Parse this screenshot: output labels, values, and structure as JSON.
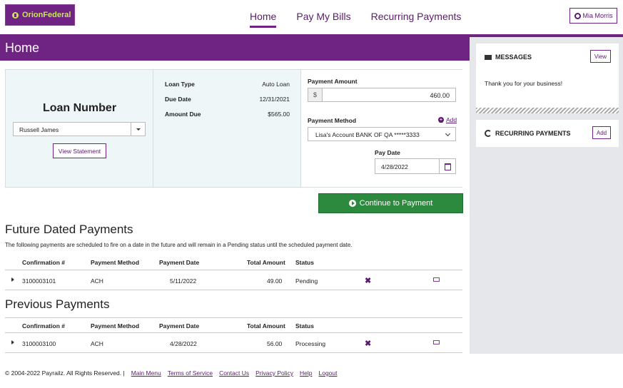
{
  "brand": {
    "name": "OrionFederal"
  },
  "nav": {
    "items": [
      "Home",
      "Pay My Bills",
      "Recurring Payments"
    ],
    "active": "Home"
  },
  "user": {
    "name": "Mia Morris",
    "icon": "gear-icon"
  },
  "page": {
    "title": "Home"
  },
  "loan": {
    "title": "Loan Number",
    "selected_account": "Russell James",
    "view_statement_label": "View Statement",
    "details": [
      {
        "label": "Loan Type",
        "value": "Auto Loan"
      },
      {
        "label": "Due Date",
        "value": "12/31/2021"
      },
      {
        "label": "Amount Due",
        "value": "$565.00"
      }
    ]
  },
  "payment": {
    "amount_label": "Payment Amount",
    "currency_prefix": "$",
    "amount_value": "460.00",
    "method_label": "Payment Method",
    "add_label": "Add",
    "method_value": "Lisa's Account BANK OF QA *****3333",
    "pay_date_label": "Pay Date",
    "pay_date_value": "4/28/2022",
    "continue_label": "Continue to Payment"
  },
  "future": {
    "title": "Future Dated Payments",
    "description": "The following payments are scheduled to fire on a date in the future and will remain in a Pending status until the scheduled payment date.",
    "columns": [
      "Confirmation #",
      "Payment Method",
      "Payment Date",
      "Total Amount",
      "Status"
    ],
    "rows": [
      {
        "confirmation": "3100003101",
        "method": "ACH",
        "date": "5/11/2022",
        "amount": "49.00",
        "status": "Pending"
      }
    ]
  },
  "previous": {
    "title": "Previous Payments",
    "columns": [
      "Confirmation #",
      "Payment Method",
      "Payment Date",
      "Total Amount",
      "Status"
    ],
    "rows": [
      {
        "confirmation": "3100003100",
        "method": "ACH",
        "date": "4/28/2022",
        "amount": "56.00",
        "status": "Processing"
      }
    ]
  },
  "messages": {
    "title": "MESSAGES",
    "view_label": "View",
    "text": "Thank you for your business!"
  },
  "recurring": {
    "title": "RECURRING PAYMENTS",
    "add_label": "Add"
  },
  "footer": {
    "copyright": "© 2004-2022 Payrailz. All Rights Reserved. |",
    "links": [
      "Main Menu",
      "Terms of Service",
      "Contact Us",
      "Privacy Policy",
      "Help",
      "Logout"
    ]
  },
  "colors": {
    "brand": "#6f2382",
    "accent_green": "#2b8a3e",
    "panel_bg": "#eef6f8",
    "sidebar_bg": "#e5e7ea"
  }
}
